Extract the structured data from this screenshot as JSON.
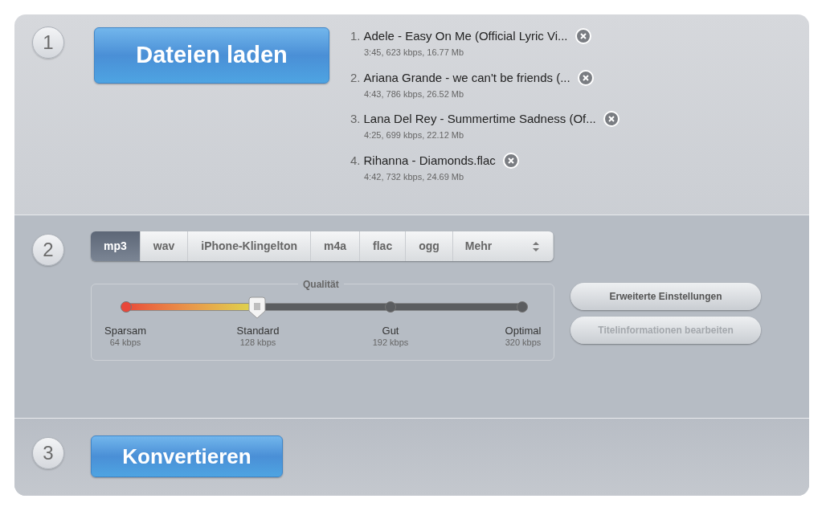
{
  "step_1": {
    "number": "1",
    "button": "Dateien laden",
    "files": [
      {
        "index": "1.",
        "name": "Adele - Easy On Me (Official Lyric Vi...",
        "info": "3:45, 623 kbps, 16.77 Mb"
      },
      {
        "index": "2.",
        "name": "Ariana Grande - we can't be friends (...",
        "info": "4:43, 786 kbps, 26.52 Mb"
      },
      {
        "index": "3.",
        "name": "Lana Del Rey - Summertime Sadness (Of...",
        "info": "4:25, 699 kbps, 22.12 Mb"
      },
      {
        "index": "4.",
        "name": "Rihanna - Diamonds.flac",
        "info": "4:42, 732 kbps, 24.69 Mb"
      }
    ]
  },
  "step_2": {
    "number": "2",
    "formats": [
      {
        "label": "mp3",
        "kind": "format",
        "selected": true
      },
      {
        "label": "wav",
        "kind": "format",
        "selected": false
      },
      {
        "label": "iPhone-Klingelton",
        "kind": "format",
        "selected": false
      },
      {
        "label": "m4a",
        "kind": "format",
        "selected": false
      },
      {
        "label": "flac",
        "kind": "format",
        "selected": false
      },
      {
        "label": "ogg",
        "kind": "format",
        "selected": false
      },
      {
        "label": "Mehr",
        "kind": "dropdown",
        "selected": false
      }
    ],
    "quality": {
      "legend": "Qualität",
      "level": 0.33,
      "stops": [
        {
          "label": "Sparsam",
          "rate": "64 kbps"
        },
        {
          "label": "Standard",
          "rate": "128 kbps"
        },
        {
          "label": "Gut",
          "rate": "192 kbps"
        },
        {
          "label": "Optimal",
          "rate": "320 kbps"
        }
      ]
    },
    "buttons": [
      {
        "label": "Erweiterte Einstellungen",
        "disabled": false
      },
      {
        "label": "Titelinformationen bearbeiten",
        "disabled": true
      }
    ]
  },
  "step_3": {
    "number": "3",
    "button": "Konvertieren"
  }
}
